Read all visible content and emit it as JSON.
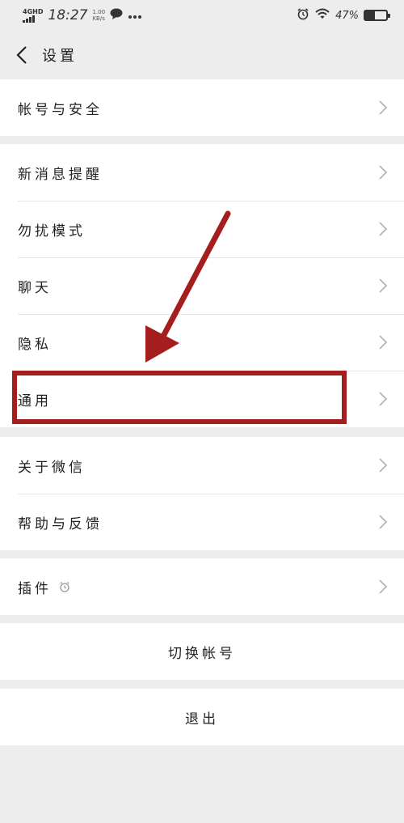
{
  "status_bar": {
    "network": "4GHD",
    "time": "18:27",
    "speed_value": "1.00",
    "speed_unit": "KB/s",
    "battery_pct": "47%",
    "battery_level": 0.47
  },
  "navbar": {
    "title": "设置"
  },
  "groups": {
    "account": {
      "label": "帐号与安全"
    },
    "settings": {
      "items": [
        "新消息提醒",
        "勿扰模式",
        "聊天",
        "隐私",
        "通用"
      ]
    },
    "about": {
      "items": [
        "关于微信",
        "帮助与反馈"
      ]
    },
    "plugins": {
      "label": "插件"
    }
  },
  "actions": {
    "switch_account": "切换帐号",
    "logout": "退出"
  },
  "annotation": {
    "color": "#a41e1e",
    "highlight_target": "通用"
  }
}
